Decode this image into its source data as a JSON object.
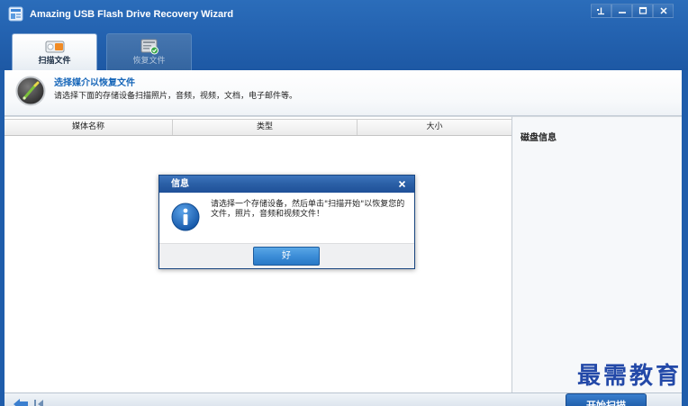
{
  "app": {
    "title": "Amazing USB Flash Drive Recovery Wizard",
    "icon": "usb-app-icon"
  },
  "window_controls": [
    {
      "icon": "pin-icon"
    },
    {
      "icon": "minimize-icon"
    },
    {
      "icon": "maximize-icon"
    },
    {
      "icon": "close-icon"
    }
  ],
  "tabs": [
    {
      "label": "扫描文件",
      "icon": "scan-files-icon",
      "active": true
    },
    {
      "label": "恢复文件",
      "icon": "recover-files-icon",
      "active": false
    }
  ],
  "header": {
    "icon": "select-media-icon",
    "title": "选择媒介以恢复文件",
    "subtitle": "请选择下面的存储设备扫描照片，音频，视频，文档，电子邮件等。"
  },
  "media_table": {
    "columns": [
      "媒体名称",
      "类型",
      "大小"
    ],
    "rows": []
  },
  "disk_info": {
    "title": "磁盘信息"
  },
  "dialog": {
    "title": "信息",
    "icon": "info-icon",
    "close_icon": "close-icon",
    "message_lines": [
      "请选择一个存储设备，然后单击\"扫描开始\"以恢复您的",
      "文件，照片，音频和视频文件！"
    ],
    "ok_label": "好"
  },
  "footer": {
    "nav_icons": [
      "back-arrow-icon",
      "previous-icon"
    ],
    "start_scan_label": "开始扫描"
  },
  "watermark": "最需教育",
  "colors": {
    "frame_blue": "#1f5dab",
    "accent_title": "#1565b8",
    "watermark": "#2349a8",
    "dialog_title": "#2a5fa6",
    "ok_button": "#3a8bd6"
  }
}
